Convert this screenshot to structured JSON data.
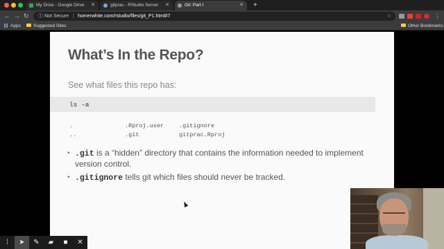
{
  "browser": {
    "tabs": [
      {
        "title": "My Drive - Google Drive",
        "active": false,
        "favicon_color": "#34a853"
      },
      {
        "title": "gitprac - RStudio Server",
        "active": false,
        "favicon_color": "#75aadb"
      },
      {
        "title": "Git: Part I",
        "active": true,
        "favicon_color": "#9e9e9e"
      }
    ],
    "new_tab": "+",
    "security_label": "Not Secure",
    "url": "homerwhite.com/rstudio/files/git_P1.html#7",
    "bookmarks": {
      "apps": "Apps",
      "suggested": "Suggested Sites",
      "other": "Other Bookmarks"
    }
  },
  "slide": {
    "title": "What’s In the Repo?",
    "subtitle": "See what files this repo has:",
    "command": "ls -a",
    "listing": {
      "row1": [
        ".",
        ".Rproj.user",
        ".gitignore"
      ],
      "row2": [
        "..",
        ".git",
        "gitprac.Rproj"
      ]
    },
    "bullets": [
      {
        "code": ".git",
        "text": " is a “hidden” directory that contains the information needed to implement version control."
      },
      {
        "code": ".gitignore",
        "text": " tells git which files should never be tracked."
      }
    ]
  },
  "annotation_toolbar": {
    "tools": [
      "grid-icon",
      "pointer-icon",
      "pen-icon",
      "highlighter-icon",
      "camera-icon",
      "close-icon"
    ]
  }
}
